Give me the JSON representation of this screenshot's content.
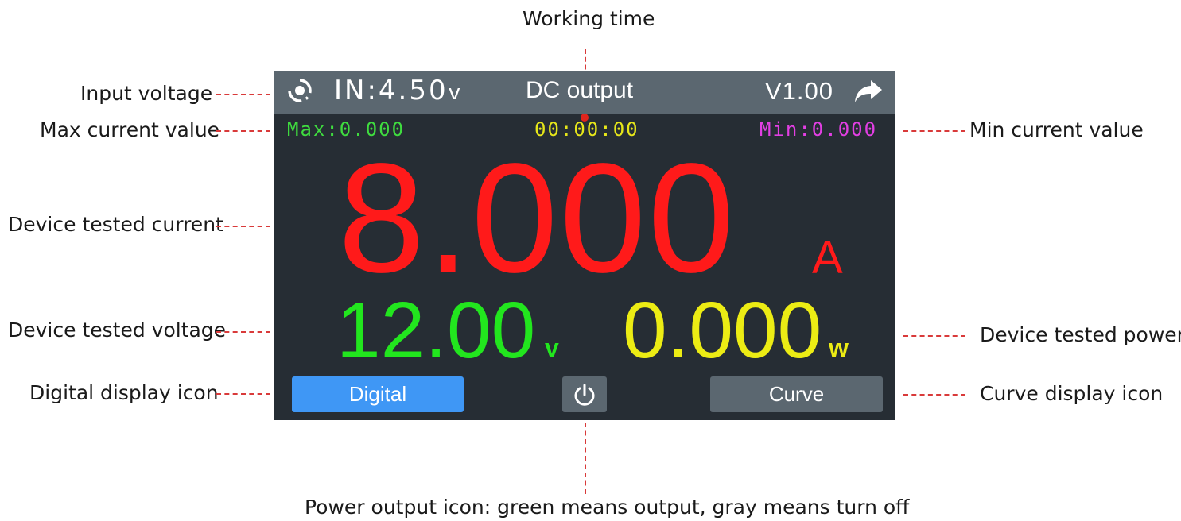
{
  "screen": {
    "topbar": {
      "input_label": "IN:4.50",
      "input_unit": "v",
      "title": "DC output",
      "version": "V1.00",
      "icons": [
        "refresh-icon",
        "share-icon"
      ]
    },
    "stats": {
      "max": "Max:0.000",
      "timer": "00:00:00",
      "min": "Min:0.000"
    },
    "readings": {
      "current": "8.000",
      "current_unit": "A",
      "voltage": "12.00",
      "voltage_unit": "v",
      "power": "0.000",
      "power_unit": "w"
    },
    "buttons": {
      "digital": "Digital",
      "curve": "Curve",
      "power_icon": "power-icon"
    }
  },
  "annotations": {
    "working_time": "Working time",
    "input_voltage": "Input voltage",
    "max_current": "Max current value",
    "min_current": "Min current value",
    "device_current": "Device tested current",
    "device_voltage": "Device tested voltage",
    "device_power": "Device tested power",
    "digital_icon": "Digital display icon",
    "curve_icon": "Curve display icon",
    "power_icon": "Power output icon: green means output, gray means turn off"
  },
  "colors": {
    "screen_bg": "#262d34",
    "topbar_bg": "#5b6770",
    "current": "#ff1a1a",
    "voltage": "#22e61e",
    "power": "#ecec14",
    "max": "#3fdc3f",
    "min": "#e23fe3",
    "timer": "#e6e61a",
    "digital_button": "#3f97f5",
    "leader_line": "#d93a3a"
  }
}
